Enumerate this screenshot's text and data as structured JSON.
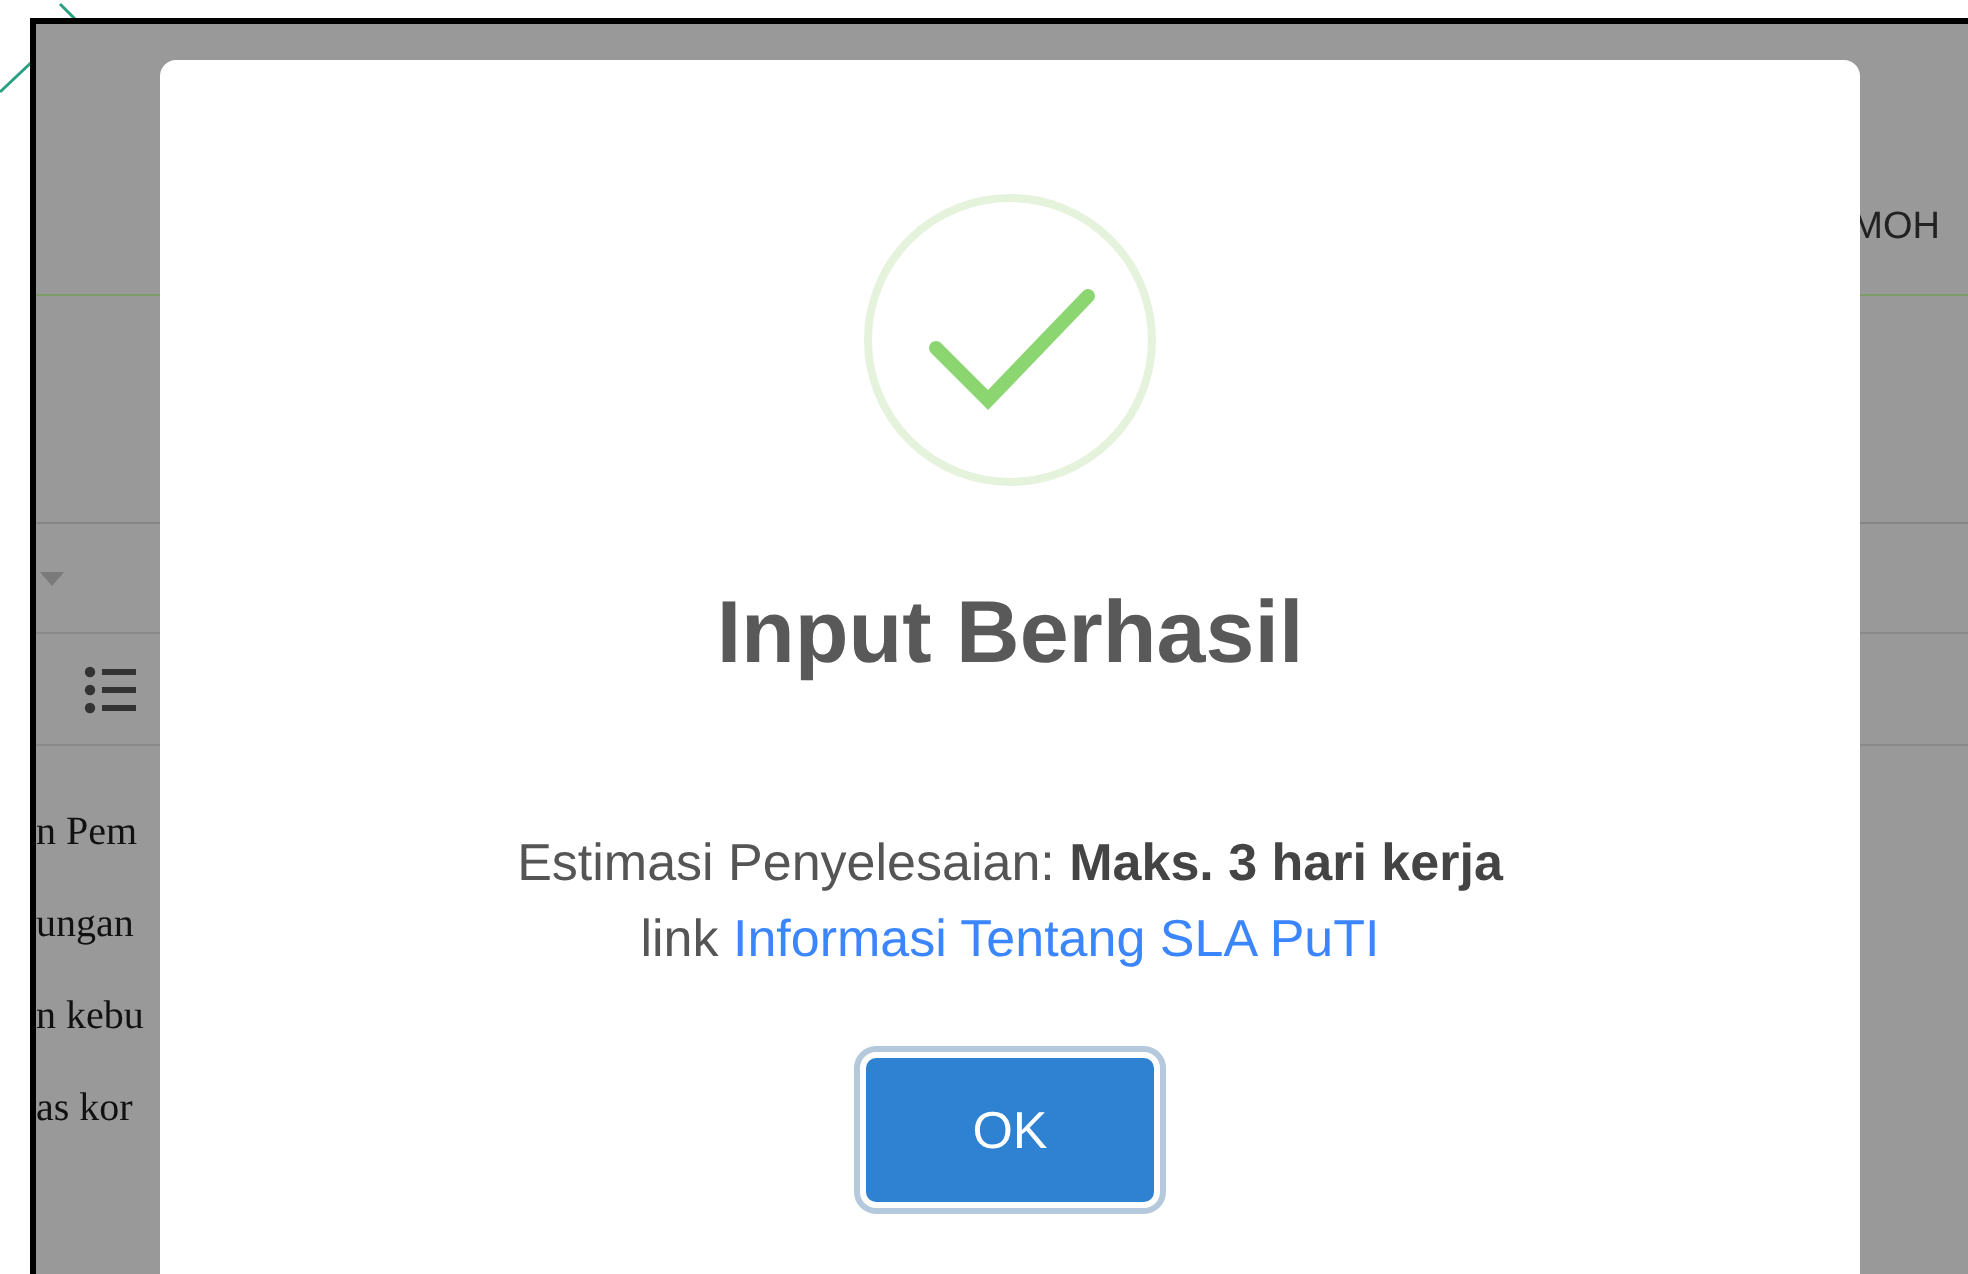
{
  "background_page": {
    "header_text": "MOH",
    "text_lines": [
      "n Pem",
      "ungan",
      "n kebu",
      "as kor"
    ]
  },
  "dialog": {
    "title": "Input Berhasil",
    "message": "Estimasi Penyelesaian: **Maks. 3 hari kerja**",
    "link_prefix": "link",
    "link_text": "Informasi Tentang SLA PuTI",
    "button": "OK"
  }
}
